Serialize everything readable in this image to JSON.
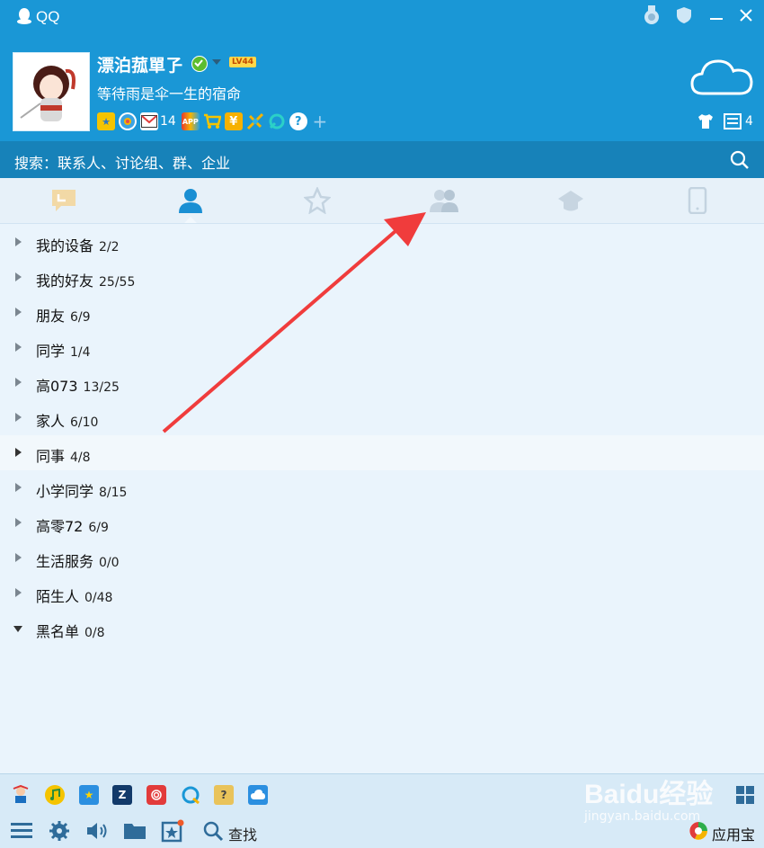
{
  "window": {
    "title": "QQ"
  },
  "profile": {
    "nickname": "漂泊菰單孒",
    "level_badge": "LV44",
    "signature": "等待雨是伞一生的宿命",
    "mail_count": "14",
    "message_count": "4"
  },
  "search": {
    "placeholder": "搜索：联系人、讨论组、群、企业"
  },
  "tabs": [
    {
      "icon": "message-icon"
    },
    {
      "icon": "contacts-icon",
      "active": true
    },
    {
      "icon": "favorites-icon"
    },
    {
      "icon": "group-icon"
    },
    {
      "icon": "space-icon"
    },
    {
      "icon": "phone-icon"
    }
  ],
  "groups": [
    {
      "name": "我的设备",
      "count": "2/2"
    },
    {
      "name": "我的好友",
      "count": "25/55"
    },
    {
      "name": "朋友",
      "count": "6/9"
    },
    {
      "name": "同学",
      "count": "1/4"
    },
    {
      "name": "高073",
      "count": "13/25"
    },
    {
      "name": "家人",
      "count": "6/10"
    },
    {
      "name": "同事",
      "count": "4/8"
    },
    {
      "name": "小学同学",
      "count": "8/15"
    },
    {
      "name": "高零72",
      "count": "6/9"
    },
    {
      "name": "生活服务",
      "count": "0/0"
    },
    {
      "name": "陌生人",
      "count": "0/48"
    },
    {
      "name": "黑名单",
      "count": "0/8"
    }
  ],
  "bottom": {
    "find_label": "查找",
    "app_store_label": "应用宝"
  },
  "watermark": {
    "logo_text": "Baidu经验",
    "url": "jingyan.baidu.com"
  },
  "colors": {
    "header": "#1a97d6",
    "search_bar": "#1782b9",
    "annotation_arrow": "#f03c3c"
  }
}
